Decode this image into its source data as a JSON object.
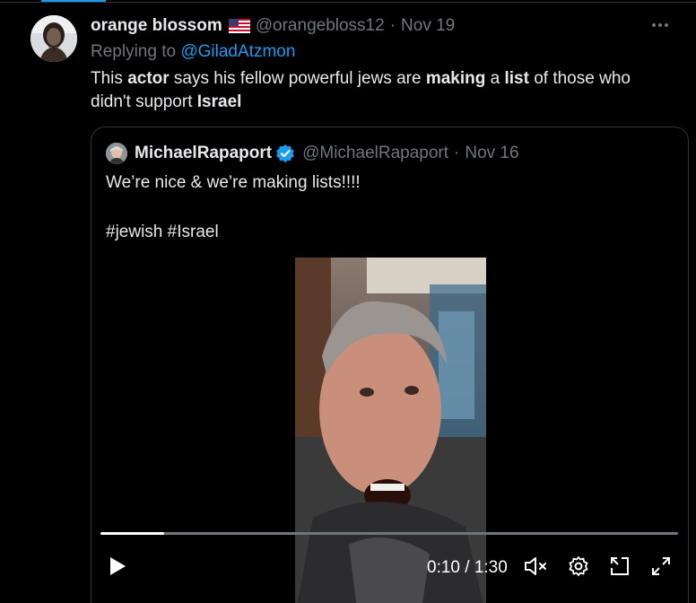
{
  "tweet": {
    "display_name": "orange blossom",
    "flag_icon": "us-flag-icon",
    "handle": "@orangebloss12",
    "separator": "·",
    "date": "Nov 19",
    "reply_prefix": "Replying to ",
    "reply_to": "@GiladAtzmon",
    "text_parts": [
      "This ",
      "actor",
      " says his fellow powerful jews are ",
      "making",
      " a ",
      "list",
      " of those who didn't support ",
      "Israel"
    ],
    "more_icon": "more-options-icon"
  },
  "quote": {
    "display_name": "MichaelRapaport",
    "verified_icon": "verified-badge-icon",
    "handle": "@MichaelRapaport",
    "separator": "·",
    "date": "Nov 16",
    "line1": "We’re nice & we’re making lists!!!!",
    "line2": "#jewish #Israel"
  },
  "video": {
    "current_time": "0:10",
    "time_separator": " / ",
    "duration": "1:30",
    "progress_fraction": 0.111,
    "play_icon": "play-icon",
    "mute_icon": "muted-speaker-icon",
    "settings_icon": "settings-gear-icon",
    "pip_icon": "picture-in-picture-icon",
    "fullscreen_icon": "fullscreen-icon"
  },
  "colors": {
    "accent": "#1d9bf0",
    "background": "#000000",
    "text_primary": "#e7e9ea",
    "text_secondary": "#71767b"
  }
}
